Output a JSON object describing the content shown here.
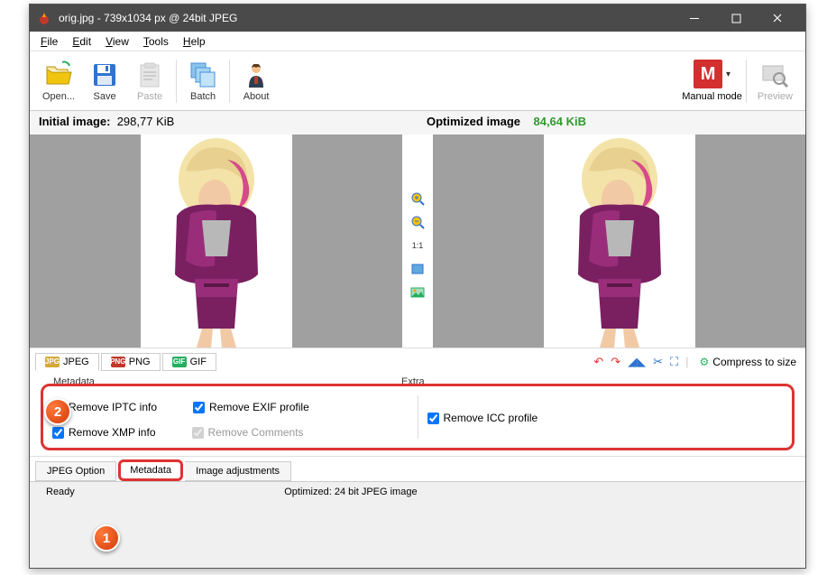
{
  "titlebar": {
    "title": "orig.jpg - 739x1034 px @ 24bit JPEG"
  },
  "menubar": {
    "file": "File",
    "edit": "Edit",
    "view": "View",
    "tools": "Tools",
    "help": "Help"
  },
  "toolbar": {
    "open": "Open...",
    "save": "Save",
    "paste": "Paste",
    "batch": "Batch",
    "about": "About",
    "mode": "Manual mode",
    "preview": "Preview"
  },
  "sizes": {
    "initial_label": "Initial image:",
    "initial_value": "298,77 KiB",
    "optimized_label": "Optimized image",
    "optimized_value": "84,64 KiB"
  },
  "zoom": {
    "ratio": "1:1"
  },
  "format_tabs": {
    "jpeg": "JPEG",
    "png": "PNG",
    "gif": "GIF"
  },
  "right_tools": {
    "compress": "Compress to size"
  },
  "fieldsets": {
    "metadata_label": "Metadata",
    "extra_label": "Extra",
    "remove_iptc": "Remove IPTC info",
    "remove_exif": "Remove EXIF profile",
    "remove_xmp": "Remove XMP info",
    "remove_comments": "Remove Comments",
    "remove_icc": "Remove ICC profile"
  },
  "bottom_tabs": {
    "jpeg_options": "JPEG Option",
    "metadata": "Metadata",
    "image_adj": "Image adjustments"
  },
  "statusbar": {
    "ready": "Ready",
    "optimized": "Optimized: 24 bit JPEG image"
  },
  "annotations": {
    "one": "1",
    "two": "2"
  }
}
